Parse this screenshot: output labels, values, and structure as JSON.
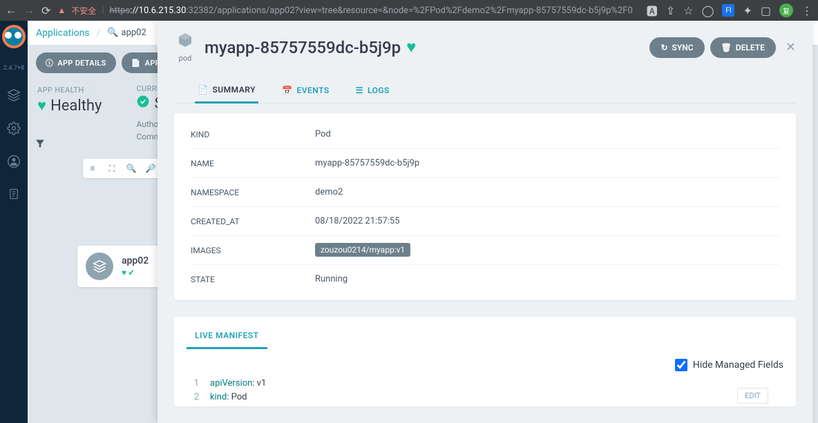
{
  "browser": {
    "insecure_label": "不安全",
    "url_proto": "https",
    "url_host": "://10.6.215.30",
    "url_path": ":32382/applications/app02?view=tree&resource=&node=%2FPod%2Fdemo2%2Fmyapp-85757559dc-b5j9p%2F0",
    "avatar_initial": "复"
  },
  "version": "2.4.7+8",
  "breadcrumb": {
    "root": "Applications",
    "current": "app02"
  },
  "toolbar": {
    "app_details": "APP DETAILS",
    "app_diff": "APP DIFF"
  },
  "health": {
    "label": "APP HEALTH",
    "value": "Healthy"
  },
  "sync": {
    "label": "CURRENT",
    "value": "Syn",
    "author": "Author:",
    "comment": "Comment:"
  },
  "zoom": "100%",
  "node": {
    "name": "app02"
  },
  "overlay": {
    "kind_label": "pod",
    "title": "myapp-85757559dc-b5j9p",
    "sync_btn": "SYNC",
    "delete_btn": "DELETE",
    "tabs": {
      "summary": "SUMMARY",
      "events": "EVENTS",
      "logs": "LOGS"
    },
    "summary": {
      "kind_k": "KIND",
      "kind_v": "Pod",
      "name_k": "NAME",
      "name_v": "myapp-85757559dc-b5j9p",
      "ns_k": "NAMESPACE",
      "ns_v": "demo2",
      "created_k": "CREATED_AT",
      "created_v": "08/18/2022 21:57:55",
      "images_k": "IMAGES",
      "images_v": "zouzou0214/myapp:v1",
      "state_k": "STATE",
      "state_v": "Running"
    },
    "manifest": {
      "tab": "LIVE MANIFEST",
      "hide_label": "Hide Managed Fields",
      "line1_k": "apiVersion",
      "line1_v": ": v1",
      "line2_k": "kind",
      "line2_v": ": Pod",
      "ln1": "1",
      "ln2": "2",
      "edit": "EDIT"
    }
  }
}
